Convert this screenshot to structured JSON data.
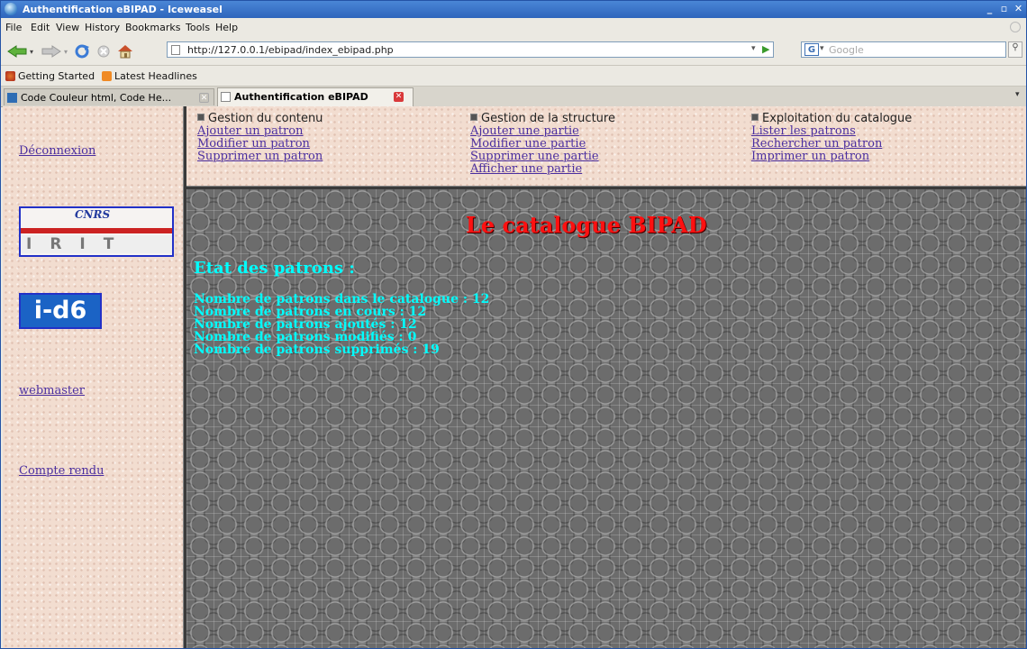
{
  "window": {
    "title": "Authentification eBIPAD - Iceweasel",
    "controls": [
      "_",
      "▫",
      "✕"
    ]
  },
  "menu": {
    "items": [
      {
        "label": "File"
      },
      {
        "label": "Edit"
      },
      {
        "label": "View"
      },
      {
        "label": "History"
      },
      {
        "label": "Bookmarks"
      },
      {
        "label": "Tools"
      },
      {
        "label": "Help"
      }
    ]
  },
  "toolbar": {
    "url": "http://127.0.0.1/ebipad/index_ebipad.php",
    "search_engine": "G",
    "search_placeholder": "Google"
  },
  "bookmarks": {
    "items": [
      {
        "label": "Getting Started",
        "icon": "firefox-icon"
      },
      {
        "label": "Latest Headlines",
        "icon": "rss-icon"
      }
    ]
  },
  "tabs": [
    {
      "label": "Code Couleur html, Code He...",
      "active": false
    },
    {
      "label": "Authentification eBIPAD",
      "active": true
    }
  ],
  "sidebar": {
    "logout": "Déconnexion",
    "logo_irit": "IRIT",
    "logo_cnrs": "CNRS",
    "logo_id6": "i-d6",
    "webmaster": "webmaster",
    "report": "Compte rendu"
  },
  "nav": {
    "columns": [
      {
        "heading": "Gestion du contenu",
        "links": [
          "Ajouter un patron",
          "Modifier un patron",
          "Supprimer un patron"
        ]
      },
      {
        "heading": "Gestion de la structure",
        "links": [
          "Ajouter une partie",
          "Modifier une partie",
          "Supprimer une partie",
          "Afficher une partie"
        ]
      },
      {
        "heading": "Exploitation du catalogue",
        "links": [
          "Lister les patrons",
          "Rechercher un patron",
          "Imprimer un patron"
        ]
      }
    ]
  },
  "main": {
    "title": "Le catalogue BIPAD",
    "state_heading": "Etat des patrons :",
    "stats": [
      "Nombre de patrons dans le catalogue : 12",
      "Nombre de patrons en cours : 12",
      "Nombre de patrons ajoutés : 12",
      "Nombre de patrons modifiés : 0",
      "Nombre de patrons supprimés : 19"
    ]
  },
  "colors": {
    "title_red": "#ff1010",
    "stats_cyan": "#00ffff",
    "link_purple": "#4b2fa0",
    "titlebar_blue": "#2e65bc"
  }
}
